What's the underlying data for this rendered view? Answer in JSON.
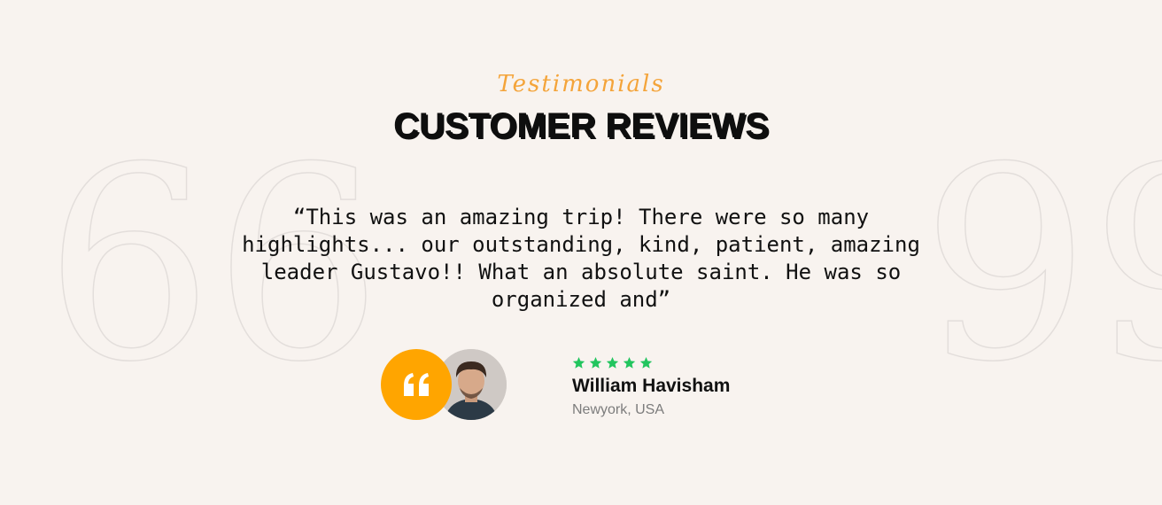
{
  "section": {
    "eyebrow": "Testimonials",
    "title": "CUSTOMER REVIEWS"
  },
  "decorations": {
    "open_quote": "66",
    "close_quote": "99"
  },
  "review": {
    "text": "“This was an amazing trip! There were so many highlights... our outstanding, kind, patient, amazing leader Gustavo!! What an absolute saint. He was so organized and”",
    "rating": 5,
    "author_name": "William Havisham",
    "author_location": "Newyork, USA"
  },
  "colors": {
    "accent": "#f4a43a",
    "badge": "#ffa500",
    "star": "#22c55e",
    "background": "#f8f3ef"
  },
  "icons": {
    "quote_badge": "quote-icon",
    "rating": "star-icon",
    "avatar": "avatar"
  }
}
